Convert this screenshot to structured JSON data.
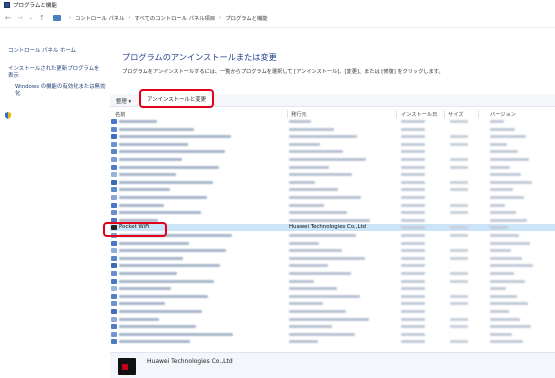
{
  "window": {
    "title": "プログラムと機能"
  },
  "address": {
    "crumbs": [
      "コントロール パネル",
      "すべてのコントロール パネル項目",
      "プログラムと機能"
    ]
  },
  "sidebar": {
    "items": [
      {
        "label": "コントロール パネル ホーム"
      },
      {
        "label": "インストールされた更新プログラムを表示"
      },
      {
        "label": "Windows の機能の有効化または無効化"
      }
    ]
  },
  "main": {
    "title": "プログラムのアンインストールまたは変更",
    "description": "プログラムをアンインストールするには、一覧からプログラムを選択して [アンインストール]、[変更]、または [修復] をクリックします。"
  },
  "toolbar": {
    "organize_label": "整理 ▾",
    "uninstall_label": "アンインストールと変更"
  },
  "columns": {
    "name": "名前",
    "publisher": "発行元",
    "installed_on": "インストール日",
    "size": "サイズ",
    "version": "バージョン"
  },
  "selected_row": {
    "name": "Pocket WiFi",
    "publisher": "Huawei Technologies Co.,Ltd"
  },
  "details": {
    "publisher": "Huawei Technologies Co.,Ltd"
  },
  "colors": {
    "highlight": "#e3001b",
    "selection": "#cce4f7",
    "title_blue": "#1e3d8f",
    "link_blue": "#1f3f7a"
  }
}
